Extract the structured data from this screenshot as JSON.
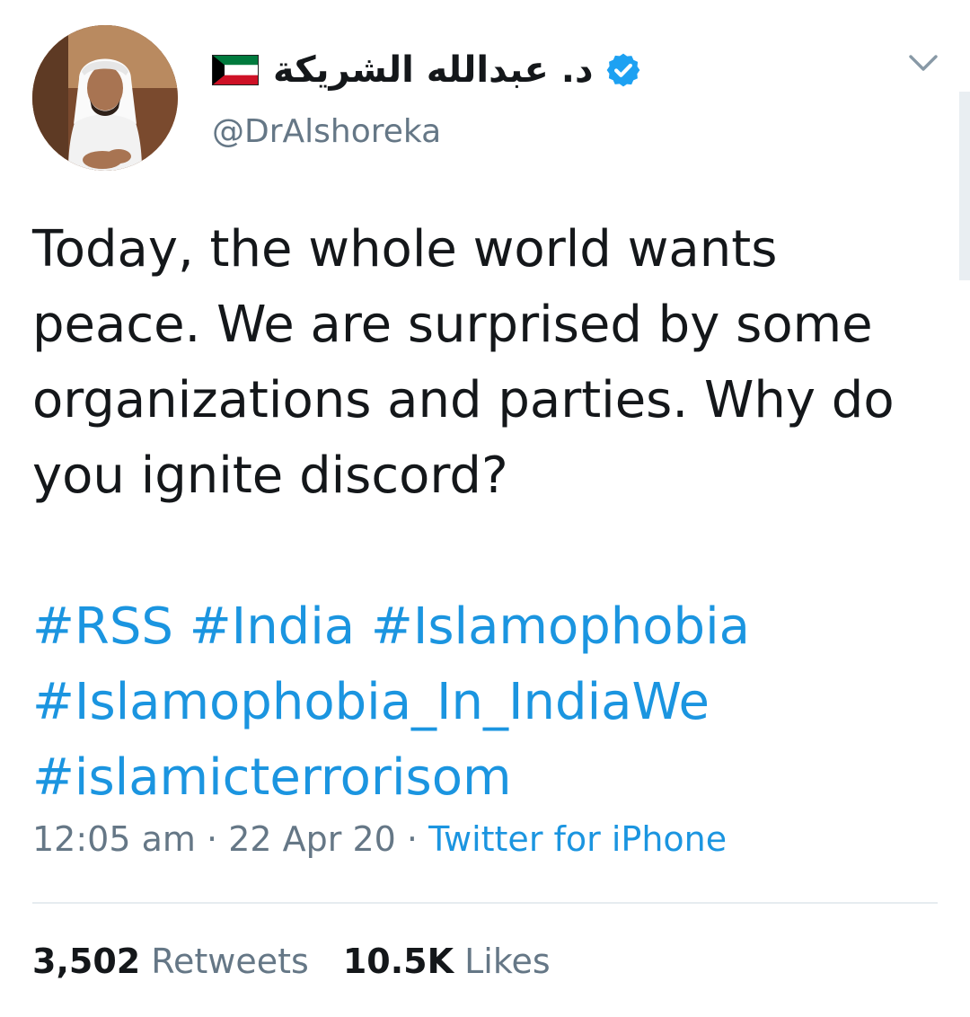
{
  "author": {
    "display_name": "د. عبدالله الشريكة",
    "handle": "@DrAlshoreka",
    "avatar_icon": "person-avatar",
    "flag_icon": "kuwait-flag-icon",
    "verified_icon": "verified-badge-icon"
  },
  "tweet": {
    "text": "Today, the whole world wants peace. We are surprised by some organizations and parties. Why do you ignite discord?",
    "hashtags": [
      "#RSS",
      "#India",
      "#Islamophobia",
      "#Islamophobia_In_IndiaWe",
      "#islamicterrorisom"
    ]
  },
  "meta": {
    "time": "12:05 am",
    "separator": "·",
    "date": "22 Apr 20",
    "source": "Twitter for iPhone"
  },
  "stats": {
    "retweets_count": "3,502",
    "retweets_label": "Retweets",
    "likes_count": "10.5K",
    "likes_label": "Likes"
  },
  "colors": {
    "link": "#1b95e0",
    "secondary_text": "#657786",
    "primary_text": "#14171a",
    "verified": "#1da1f2",
    "divider": "#e6ecf0"
  }
}
